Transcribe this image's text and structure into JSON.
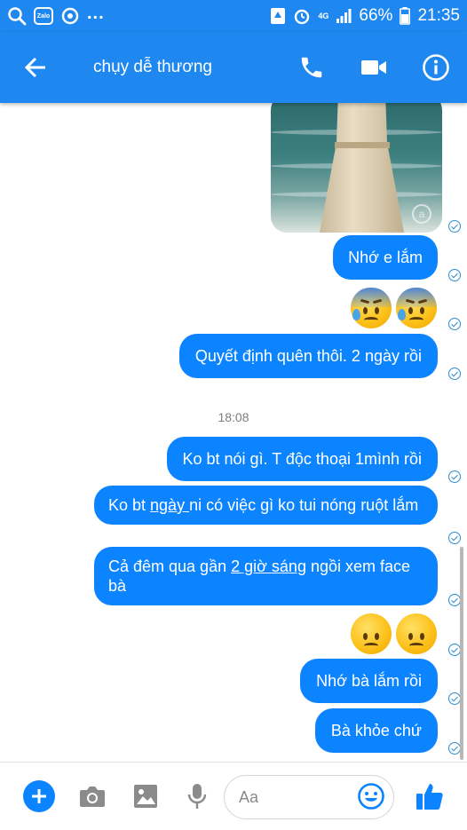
{
  "status_bar": {
    "carrier_icon": "zalo-icon",
    "zalo_label": "Zalo",
    "overflow": "...",
    "network": "4G",
    "battery": "66%",
    "time": "21:35"
  },
  "header": {
    "title": "chụy dễ thương",
    "icons": [
      "back-arrow-icon",
      "phone-icon",
      "video-camera-icon",
      "info-icon"
    ]
  },
  "messages": [
    {
      "type": "image",
      "description_icon": "photo-thumbnail"
    },
    {
      "type": "text",
      "text": "Nhớ e lắm"
    },
    {
      "type": "emoji",
      "icons": [
        "cold-sweat-emoji",
        "cold-sweat-emoji"
      ]
    },
    {
      "type": "text",
      "text": "Quyết định quên thôi. 2 ngày rồi"
    },
    {
      "type": "timestamp",
      "text": "18:08"
    },
    {
      "type": "text",
      "text": "Ko bt nói gì. T độc thoại 1mình rồi"
    },
    {
      "type": "text",
      "parts": [
        "Ko bt ",
        "ngày ",
        "ni có việc gì ko tui nóng ruột lắm"
      ]
    },
    {
      "type": "text",
      "parts": [
        "Cả đêm qua gần ",
        "2 giờ sáng",
        " ngồi xem face bà"
      ]
    },
    {
      "type": "emoji",
      "icons": [
        "frowning-emoji",
        "frowning-emoji"
      ]
    },
    {
      "type": "text",
      "text": "Nhớ bà lắm rồi"
    },
    {
      "type": "text",
      "text": "Bà khỏe chứ"
    }
  ],
  "composer": {
    "placeholder": "Aa",
    "icons": [
      "plus-icon",
      "camera-icon",
      "image-icon",
      "microphone-icon",
      "smiley-icon",
      "thumbs-up-icon"
    ]
  },
  "colors": {
    "accent": "#1e88f0",
    "bubble": "#0c84ff",
    "check": "#2f8ccf"
  }
}
